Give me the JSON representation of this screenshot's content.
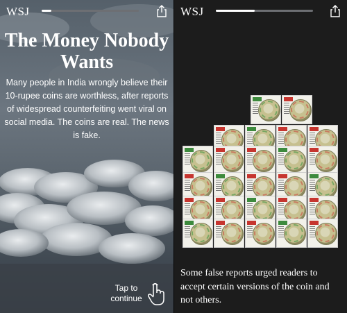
{
  "left_slide": {
    "logo": "WSJ",
    "progress": 0.1,
    "title": "The Money Nobody Wants",
    "body": "Many people in India wrongly believe their 10-rupee coins are worthless, after reports of widespread counterfeiting went viral on social media. The coins are real. The news is fake.",
    "tap_hint": "Tap to continue",
    "share_icon": "share-icon",
    "hand_icon": "tap-hand-icon"
  },
  "right_slide": {
    "logo": "WSJ",
    "progress": 0.4,
    "caption": "Some false reports urged readers to accept certain versions of the coin and not others.",
    "share_icon": "share-icon"
  },
  "colors": {
    "progress_track": "#6d6f73",
    "progress_fill": "#ffffff",
    "dark_bg": "#1c1c1c"
  }
}
